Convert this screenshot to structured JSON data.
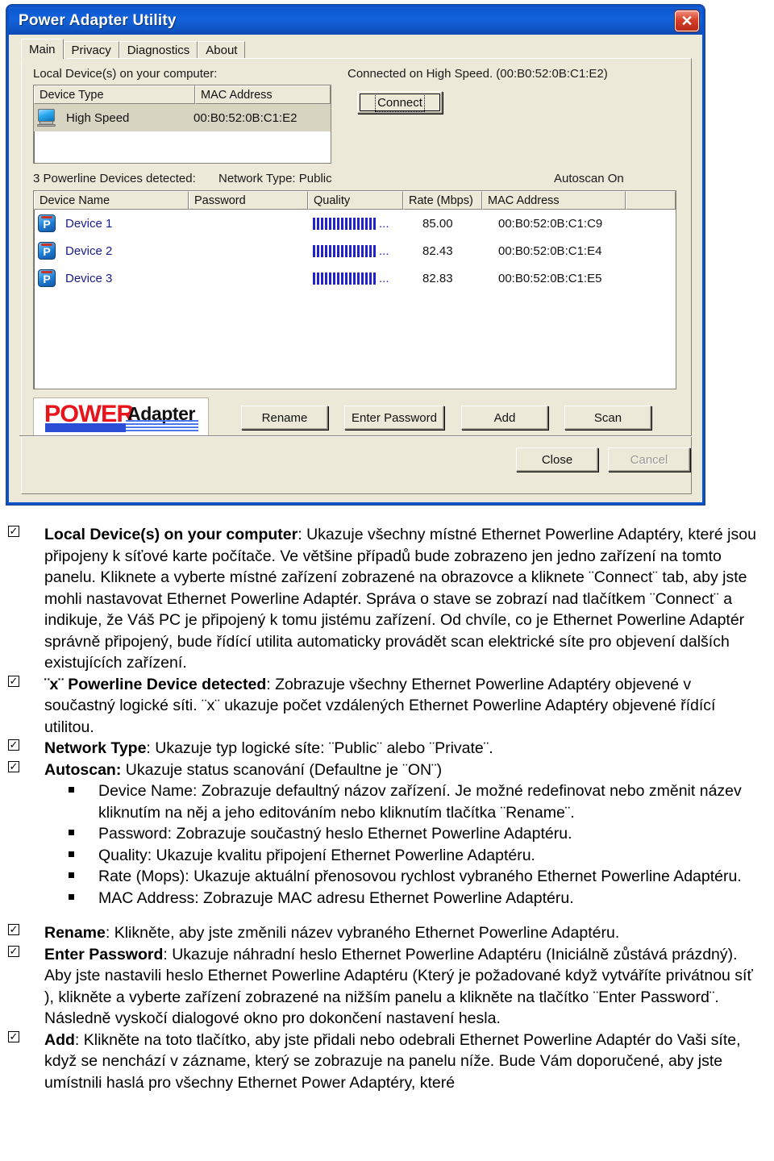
{
  "window": {
    "title": "Power Adapter Utility",
    "close_icon": "close-icon",
    "close_label": "✕"
  },
  "tabs": [
    {
      "label": "Main",
      "active": true
    },
    {
      "label": "Privacy",
      "active": false
    },
    {
      "label": "Diagnostics",
      "active": false
    },
    {
      "label": "About",
      "active": false
    }
  ],
  "local": {
    "section_label": "Local Device(s) on your computer:",
    "columns": [
      "Device Type",
      "MAC Address"
    ],
    "rows": [
      {
        "icon": "monitor-icon",
        "device_type": "High Speed",
        "mac": "00:B0:52:0B:C1:E2"
      }
    ],
    "status_text": "Connected on  High Speed. (00:B0:52:0B:C1:E2)",
    "connect_label": "Connect"
  },
  "remote": {
    "detected_label": "3 Powerline Devices detected:",
    "network_type_label": "Network Type: Public",
    "autoscan_label": "Autoscan On",
    "columns": [
      "Device Name",
      "Password",
      "Quality",
      "Rate (Mbps)",
      "MAC Address",
      ""
    ],
    "rows": [
      {
        "icon": "powerline-device-icon",
        "name": "Device 1",
        "password": "",
        "quality_bars": 16,
        "quality_suffix": "...",
        "rate": "85.00",
        "mac": "00:B0:52:0B:C1:C9"
      },
      {
        "icon": "powerline-device-icon",
        "name": "Device 2",
        "password": "",
        "quality_bars": 16,
        "quality_suffix": "...",
        "rate": "82.43",
        "mac": "00:B0:52:0B:C1:E4"
      },
      {
        "icon": "powerline-device-icon",
        "name": "Device 3",
        "password": "",
        "quality_bars": 16,
        "quality_suffix": "...",
        "rate": "82.83",
        "mac": "00:B0:52:0B:C1:E5"
      }
    ]
  },
  "logo": {
    "word1": "POWER",
    "word2": "Adapter"
  },
  "actions": {
    "rename": "Rename",
    "enter_password": "Enter Password",
    "add": "Add",
    "scan": "Scan",
    "close": "Close",
    "cancel": "Cancel"
  },
  "doc": {
    "items": [
      {
        "kind": "check",
        "runs": [
          {
            "t": "Local Device(s) on your computer",
            "b": true
          },
          {
            "t": ": Ukazuje všechny místné Ethernet Powerline Adaptéry, které jsou připojeny k síťové karte počítače. Ve většine případů bude zobrazeno jen jedno zařízení na tomto panelu. Kliknete a vyberte místné zařízení zobrazené na obrazovce  a kliknete ¨Connect¨ tab, aby jste mohli nastavovat Ethernet Powerline Adaptér. Správa o stave se zobrazí nad tlačítkem ¨Connect¨ a indikuje, že Váš PC je připojený k tomu jistému zařízení. Od chvíle, co je Ethernet Powerline Adaptér správně připojený, bude řídící utilita automaticky provádět scan elektrické síte pro objevení dalších existujících zařízení.",
            "b": false
          }
        ]
      },
      {
        "kind": "check",
        "runs": [
          {
            "t": "¨x¨ Powerline Device detected",
            "b": true
          },
          {
            "t": ": Zobrazuje všechny Ethernet Powerline Adaptéry objevené v součastný logické síti. ¨x¨ ukazuje počet vzdálených Ethernet Powerline Adaptéry objevené řídící utilitou.",
            "b": false
          }
        ]
      },
      {
        "kind": "check",
        "runs": [
          {
            "t": "Network Type",
            "b": true
          },
          {
            "t": ": Ukazuje typ logické síte: ¨Public¨ alebo ¨Private¨.",
            "b": false
          }
        ]
      },
      {
        "kind": "check",
        "runs": [
          {
            "t": "Autoscan:",
            "b": true
          },
          {
            "t": " Ukazuje status scanování (Defaultne je ¨ON¨)",
            "b": false
          }
        ]
      },
      {
        "kind": "square",
        "runs": [
          {
            "t": "Device Name: Zobrazuje defaultný názov zařízení. Je možné redefinovat nebo změnit název kliknutím na něj a jeho editováním nebo kliknutím tlačítka ¨Rename¨.",
            "b": false
          }
        ]
      },
      {
        "kind": "square",
        "runs": [
          {
            "t": "Password: Zobrazuje součastný heslo Ethernet Powerline Adaptéru.",
            "b": false
          }
        ]
      },
      {
        "kind": "square",
        "runs": [
          {
            "t": "Quality: Ukazuje kvalitu připojení Ethernet Powerline Adaptéru.",
            "b": false
          }
        ]
      },
      {
        "kind": "square",
        "runs": [
          {
            "t": "Rate (Mops): Ukazuje aktuální přenosovou rychlost vybraného Ethernet Powerline Adaptéru.",
            "b": false
          }
        ]
      },
      {
        "kind": "square",
        "runs": [
          {
            "t": "MAC Address: Zobrazuje MAC adresu Ethernet Powerline Adaptéru.",
            "b": false
          }
        ]
      },
      {
        "kind": "gap",
        "runs": []
      },
      {
        "kind": "check",
        "runs": [
          {
            "t": "Rename",
            "b": true
          },
          {
            "t": ": Klikněte, aby jste změnili název vybraného Ethernet Powerline Adaptéru.",
            "b": false
          }
        ]
      },
      {
        "kind": "check",
        "runs": [
          {
            "t": "Enter Password",
            "b": true
          },
          {
            "t": ": Ukazuje náhradní heslo Ethernet Powerline Adaptéru (Iniciálně zůstává prázdný). Aby jste nastavili heslo Ethernet Powerline Adaptéru (Který je požadované když vytváříte privátnou síť ), klikněte a vyberte zařízení zobrazené na nižším panelu a klikněte na tlačítko ¨Enter Password¨.  Následně vyskočí dialogové okno pro dokončení nastavení hesla.",
            "b": false
          }
        ]
      },
      {
        "kind": "check",
        "runs": [
          {
            "t": "Add",
            "b": true
          },
          {
            "t": ":  Klikněte na toto tlačítko, aby jste přidali nebo odebrali Ethernet Powerline Adaptér do Vaši síte, když se nenchází v zázname, který se zobrazuje na panelu níže. Bude Vám doporučené, aby jste umístnili haslá pro všechny Ethernet Power Adaptéry, které",
            "b": false
          }
        ]
      }
    ]
  }
}
